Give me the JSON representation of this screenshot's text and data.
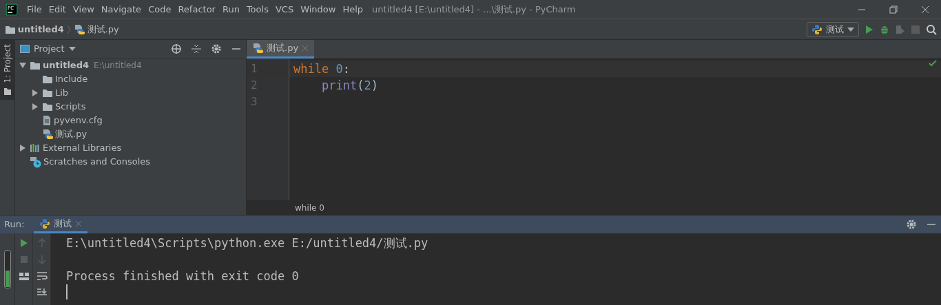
{
  "window": {
    "logo": "PC",
    "title": "untitled4 [E:\\untitled4] - ...\\测试.py - PyCharm"
  },
  "menu": [
    "File",
    "Edit",
    "View",
    "Navigate",
    "Code",
    "Refactor",
    "Run",
    "Tools",
    "VCS",
    "Window",
    "Help"
  ],
  "breadcrumb": [
    {
      "label": "untitled4",
      "kind": "folder"
    },
    {
      "label": "测试.py",
      "kind": "python"
    }
  ],
  "run_config": {
    "label": "测试"
  },
  "left_strip": {
    "label": "1: Project"
  },
  "project_panel": {
    "title": "Project",
    "tree": [
      {
        "label": "untitled4",
        "hint": "E:\\untitled4",
        "kind": "folder",
        "expanded": true,
        "children": [
          {
            "label": "Include",
            "kind": "folder"
          },
          {
            "label": "Lib",
            "kind": "folder",
            "expanded": false
          },
          {
            "label": "Scripts",
            "kind": "folder",
            "expanded": false
          },
          {
            "label": "pyvenv.cfg",
            "kind": "file"
          },
          {
            "label": "测试.py",
            "kind": "python"
          }
        ]
      },
      {
        "label": "External Libraries",
        "kind": "libraries",
        "expanded": false
      },
      {
        "label": "Scratches and Consoles",
        "kind": "scratches"
      }
    ]
  },
  "editor": {
    "tabs": [
      {
        "label": "测试.py",
        "selected": true
      }
    ],
    "lines": [
      {
        "number": "1",
        "indented": false,
        "tokens": [
          {
            "text": "while",
            "kind": "keyword"
          },
          {
            "text": "0",
            "kind": "number"
          },
          {
            "text": ":",
            "kind": "plain"
          }
        ]
      },
      {
        "number": "2",
        "indented": true,
        "tokens": [
          {
            "text": "print",
            "kind": "builtin"
          },
          {
            "text": "(",
            "kind": "plain"
          },
          {
            "text": "2",
            "kind": "number"
          },
          {
            "text": ")",
            "kind": "plain"
          }
        ]
      },
      {
        "number": "3"
      }
    ],
    "breadcrumb": "while 0"
  },
  "run_panel": {
    "label": "Run:",
    "tabs": [
      {
        "label": "测试",
        "selected": true
      }
    ],
    "output": [
      {
        "text": "E:\\untitled4\\Scripts\\python.exe E:/untitled4/测试.py",
        "blank_before": false
      },
      {
        "text": "Process finished with exit code 0",
        "blank_before": true
      }
    ]
  }
}
